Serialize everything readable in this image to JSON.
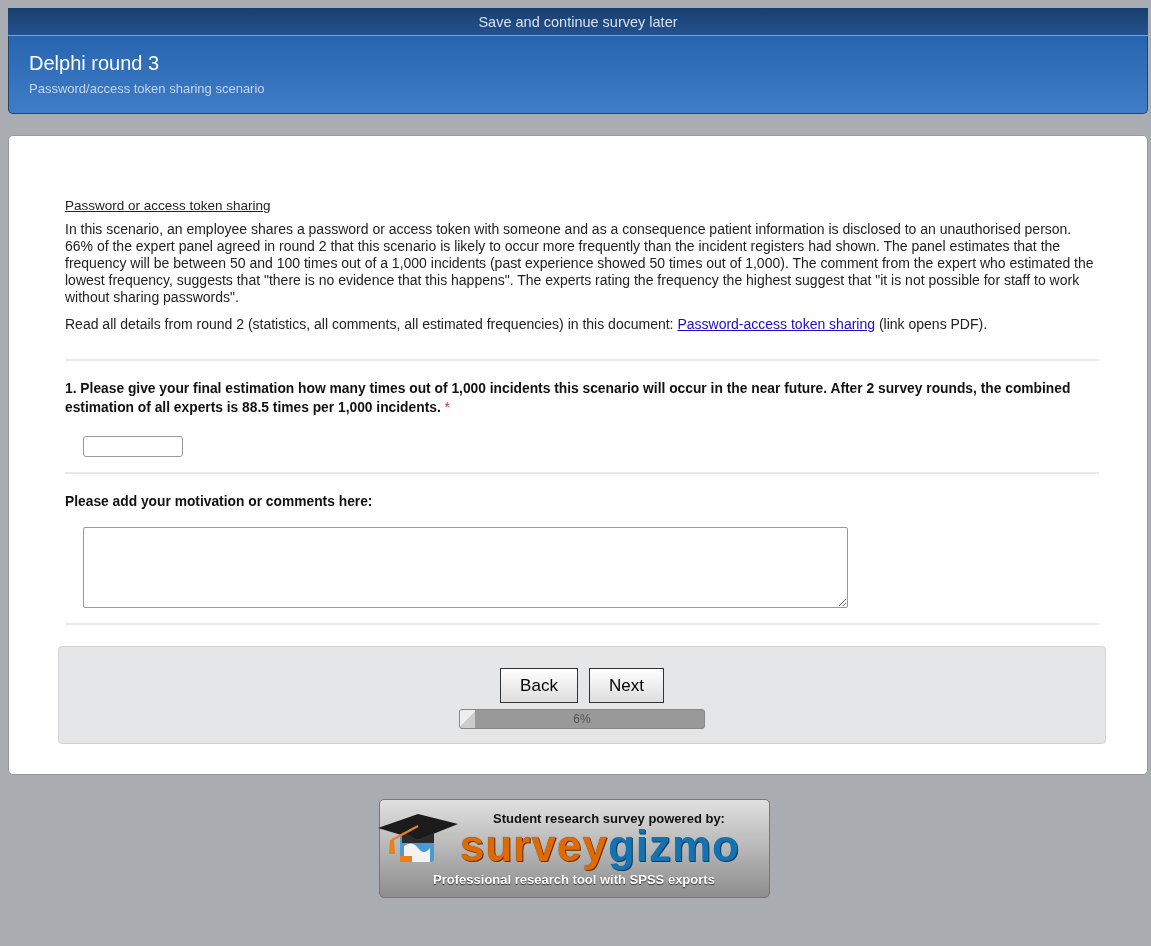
{
  "top_bar": {
    "save_link": "Save and continue survey later"
  },
  "header": {
    "title": "Delphi round 3",
    "subtitle": "Password/access token sharing scenario"
  },
  "intro": {
    "heading": "Password or access token sharing",
    "paragraph": "In this scenario, an employee shares a password or access token with someone and as a consequence patient information is disclosed to an unauthorised person. 66% of the expert panel agreed in round 2 that this scenario is likely to occur more frequently than the incident registers had shown. The panel estimates that the frequency will be between 50 and 100 times out of a 1,000 incidents (past experience showed 50 times out of 1,000). The comment from the expert who estimated the lowest frequency, suggests that \"there is no evidence that this happens\". The experts rating the frequency the highest suggest that \"it is not possible for staff to work without sharing passwords\".",
    "details_before": "Read all details from round 2 (statistics, all comments, all estimated frequencies) in this document: ",
    "details_link": "Password-access token sharing",
    "details_after": " (link opens PDF)."
  },
  "questions": [
    {
      "kind": "number",
      "label": "1. Please give your final estimation how many times out of 1,000 incidents this scenario will occur in the near future. After 2 survey rounds, the combined estimation of all experts is 88.5 times per 1,000 incidents.",
      "required_mark": "*"
    },
    {
      "kind": "essay",
      "label": "Please add your motivation or comments here:"
    }
  ],
  "navigation": {
    "buttons": [
      "Back",
      "Next"
    ],
    "progress": {
      "level": 0.06,
      "reading": "6%"
    }
  },
  "footer": {
    "top_line": "Student research survey powered by:",
    "logo_part_1": "survey",
    "logo_part_2": "gizmo",
    "bottom_line": "Professional research tool with SPSS exports"
  }
}
